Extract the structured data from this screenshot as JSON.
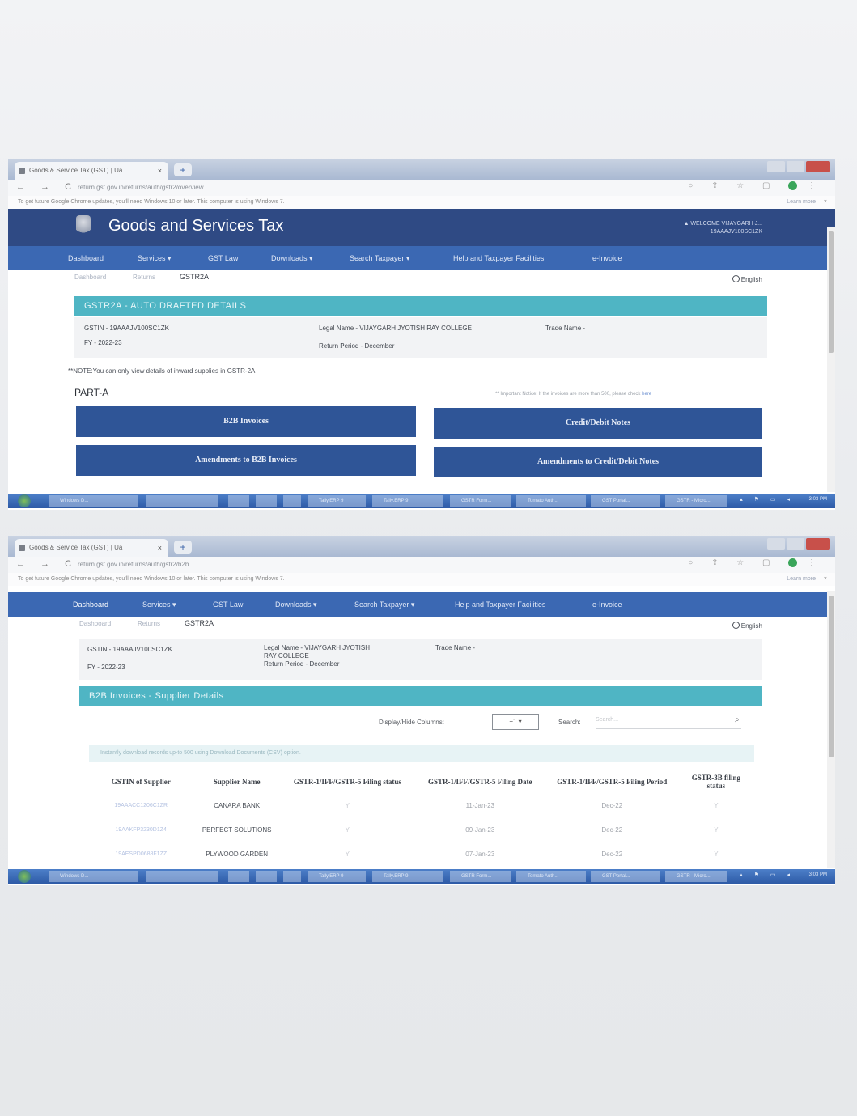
{
  "screenshot1": {
    "browser": {
      "tab_title": "Goods & Service Tax (GST) | Ua",
      "tab_close": "×",
      "new_tab": "+",
      "url": "return.gst.gov.in/returns/auth/gstr2/overview",
      "infobar_text": "To get future Google Chrome updates, you'll need Windows 10 or later. This computer is using Windows 7.",
      "learn_more": "Learn more",
      "infobar_close": "×"
    },
    "header": {
      "title": "Goods and Services Tax",
      "welcome_line1": "▲ WELCOME VIJAYGARH J...",
      "welcome_line2": "19AAAJV100SC1ZK"
    },
    "menu": [
      "Dashboard",
      "Services ▾",
      "GST Law",
      "Downloads ▾",
      "Search Taxpayer ▾",
      "Help and Taxpayer Facilities",
      "e-Invoice"
    ],
    "breadcrumb": {
      "item1": "Dashboard",
      "item2": "Returns",
      "current": "GSTR2A"
    },
    "language": "English",
    "panel_title": "GSTR2A - AUTO DRAFTED DETAILS",
    "details": {
      "gstin": "GSTIN - 19AAAJV100SC1ZK",
      "legal_name": "Legal Name - VIJAYGARH JYOTISH RAY COLLEGE",
      "trade_name": "Trade Name -",
      "fy": "FY - 2022-23",
      "return_period": "Return Period - December"
    },
    "note": "**NOTE:You can only view details of inward supplies in GSTR-2A",
    "part_label": "PART-A",
    "important_notice": "** Important Notice: If the invoices are more than 500, please check",
    "important_link": "here",
    "buttons": {
      "b2b": "B2B Invoices",
      "credit_debit": "Credit/Debit Notes",
      "amend_b2b": "Amendments to B2B Invoices",
      "amend_cdn": "Amendments to Credit/Debit Notes"
    }
  },
  "screenshot2": {
    "browser": {
      "tab_title": "Goods & Service Tax (GST) | Ua",
      "tab_close": "×",
      "new_tab": "+",
      "url": "return.gst.gov.in/returns/auth/gstr2/b2b",
      "infobar_text": "To get future Google Chrome updates, you'll need Windows 10 or later. This computer is using Windows 7.",
      "learn_more": "Learn more",
      "infobar_close": "×"
    },
    "menu": [
      "Dashboard",
      "Services ▾",
      "GST Law",
      "Downloads ▾",
      "Search Taxpayer ▾",
      "Help and Taxpayer Facilities",
      "e-Invoice"
    ],
    "breadcrumb": {
      "item1": "Dashboard",
      "item2": "Returns",
      "current": "GSTR2A"
    },
    "language": "English",
    "details": {
      "gstin": "GSTIN - 19AAAJV100SC1ZK",
      "legal_name_1": "Legal Name - VIJAYGARH JYOTISH",
      "legal_name_2": "RAY COLLEGE",
      "trade_name": "Trade Name -",
      "fy": "FY - 2022-23",
      "return_period": "Return Period - December"
    },
    "panel_title": "B2B Invoices - Supplier Details",
    "display_hide_label": "Display/Hide Columns:",
    "display_hide_value": "+1 ▾",
    "search_label": "Search:",
    "search_placeholder": "Search...",
    "csv_note": "Instantly download records up-to 500 using Download Documents (CSV) option.",
    "table": {
      "headers": [
        "GSTIN of Supplier",
        "Supplier Name",
        "GSTR-1/IFF/GSTR-5 Filing status",
        "GSTR-1/IFF/GSTR-5 Filing Date",
        "GSTR-1/IFF/GSTR-5 Filing Period",
        "GSTR-3B filing status"
      ],
      "rows": [
        {
          "gstin": "19AAACC1206C1ZR",
          "name": "CANARA BANK",
          "status": "Y",
          "date": "11-Jan-23",
          "period": "Dec-22",
          "status3b": "Y"
        },
        {
          "gstin": "19AAKFP3230D1Z4",
          "name": "PERFECT SOLUTIONS",
          "status": "Y",
          "date": "09-Jan-23",
          "period": "Dec-22",
          "status3b": "Y"
        },
        {
          "gstin": "19AESPD0688F1ZZ",
          "name": "PLYWOOD GARDEN",
          "status": "Y",
          "date": "07-Jan-23",
          "period": "Dec-22",
          "status3b": "Y"
        }
      ]
    }
  },
  "taskbar": {
    "items": [
      "Windows D...",
      "",
      "",
      "",
      "",
      "Tally.ERP 9",
      "Tally.ERP 9",
      "GSTR Form...",
      "Tomato Auth...",
      "GST Portal...",
      "GSTR - Micro..."
    ],
    "clock": "3:03 PM"
  },
  "colors": {
    "header": "#2f4a84",
    "menu": "#3b68b3",
    "panel": "#4fb5c4",
    "button": "#2f5597"
  }
}
